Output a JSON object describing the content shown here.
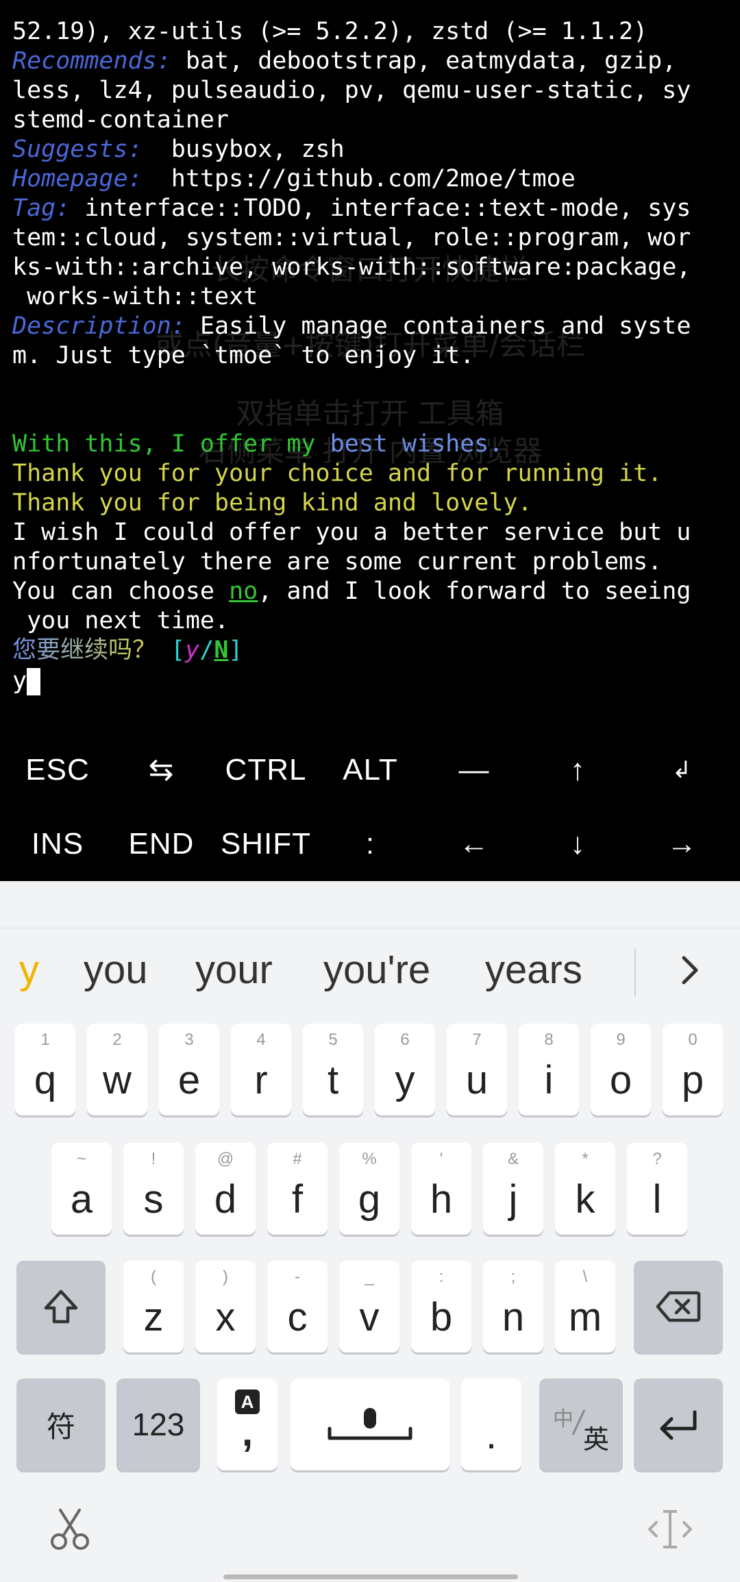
{
  "terminal": {
    "l1": "52.19), xz-utils (>= 5.2.2), zstd (>= 1.1.2)",
    "recommends_key": "Recommends:",
    "recommends_val1": " bat, debootstrap, eatmydata, gzip,",
    "recommends_val2": "less, lz4, pulseaudio, pv, qemu-user-static, sy",
    "recommends_val3": "stemd-container",
    "suggests_key": "Suggests:",
    "suggests_val": "  busybox, zsh",
    "homepage_key": "Homepage:",
    "homepage_val": "  https://github.com/2moe/tmoe",
    "tag_key": "Tag:",
    "tag_val1": " interface::TODO, interface::text-mode, sys",
    "tag_val2": "tem::cloud, system::virtual, role::program, wor",
    "tag_val3": "ks-with::archive, works-with::software:package,",
    "tag_val4": " works-with::text",
    "desc_key": "Description:",
    "desc_val1": " Easily manage containers and syste",
    "desc_val2": "m. Just type `tmoe` to enjoy it.",
    "wish_a": "With this, I offer my ",
    "wish_b": "best wishes.",
    "thanks1": "Thank you for your choice and for running it.",
    "thanks2": "Thank you for being kind and lovely.",
    "sorry1": "I wish I could offer you a better service but u",
    "sorry2": "nfortunately there are some current problems.",
    "choose_a": "You can choose ",
    "choose_no": "no",
    "choose_b": ", and I look forward to seeing",
    "nexttime": " you next time.",
    "prompt_q": "您要继续吗？",
    "prompt_open": " [",
    "prompt_y": "y",
    "prompt_slash": "/",
    "prompt_n": "N",
    "prompt_close": "]",
    "input": "y"
  },
  "watermark": {
    "w1": "长按命令窗口打开快捷栏",
    "w2": "或点(音量+按键)打开菜单/会话栏",
    "w3": "双指单击打开 工具箱",
    "w4": "右侧菜单 打开 内置 浏览器"
  },
  "extra_keys": {
    "esc": "ESC",
    "tab": "⇆",
    "ctrl": "CTRL",
    "alt": "ALT",
    "dash": "—",
    "up": "↑",
    "enter": "↲",
    "ins": "INS",
    "end": "END",
    "shift": "SHIFT",
    "colon": ":",
    "left": "←",
    "down": "↓",
    "right": "→"
  },
  "keyboard": {
    "candidates": [
      "y",
      "you",
      "your",
      "you're",
      "years"
    ],
    "row1": [
      {
        "hint": "1",
        "key": "q"
      },
      {
        "hint": "2",
        "key": "w"
      },
      {
        "hint": "3",
        "key": "e"
      },
      {
        "hint": "4",
        "key": "r"
      },
      {
        "hint": "5",
        "key": "t"
      },
      {
        "hint": "6",
        "key": "y"
      },
      {
        "hint": "7",
        "key": "u"
      },
      {
        "hint": "8",
        "key": "i"
      },
      {
        "hint": "9",
        "key": "o"
      },
      {
        "hint": "0",
        "key": "p"
      }
    ],
    "row2": [
      {
        "hint": "~",
        "key": "a"
      },
      {
        "hint": "!",
        "key": "s"
      },
      {
        "hint": "@",
        "key": "d"
      },
      {
        "hint": "#",
        "key": "f"
      },
      {
        "hint": "%",
        "key": "g"
      },
      {
        "hint": "'",
        "key": "h"
      },
      {
        "hint": "&",
        "key": "j"
      },
      {
        "hint": "*",
        "key": "k"
      },
      {
        "hint": "?",
        "key": "l"
      }
    ],
    "row3": [
      {
        "hint": "(",
        "key": "z"
      },
      {
        "hint": ")",
        "key": "x"
      },
      {
        "hint": "-",
        "key": "c"
      },
      {
        "hint": "_",
        "key": "v"
      },
      {
        "hint": ":",
        "key": "b"
      },
      {
        "hint": ";",
        "key": "n"
      },
      {
        "hint": "\\",
        "key": "m"
      }
    ],
    "symbol_key": "符",
    "num_key": "123",
    "comma": ",",
    "period": ".",
    "lang_a": "中",
    "lang_b": "英"
  }
}
